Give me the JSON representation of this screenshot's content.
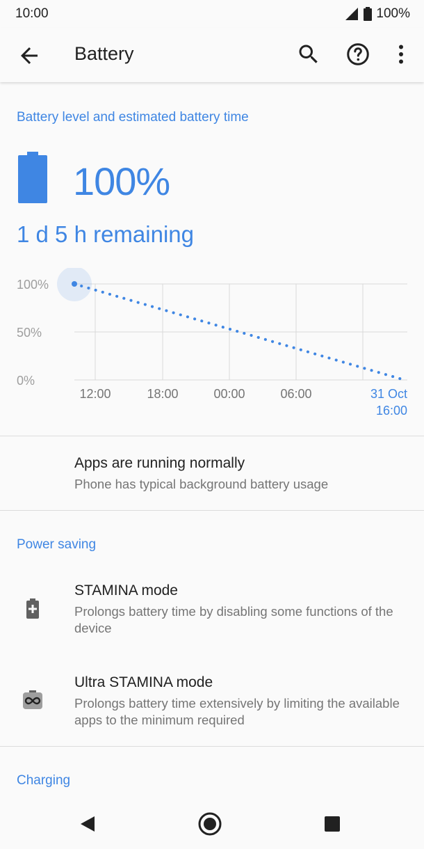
{
  "status_bar": {
    "time": "10:00",
    "battery_text": "100%"
  },
  "app_bar": {
    "title": "Battery",
    "back_icon": "arrow-back-icon",
    "search_icon": "search-icon",
    "help_icon": "help-icon",
    "more_icon": "more-vert-icon"
  },
  "battery_section": {
    "heading": "Battery level and estimated battery time",
    "percent": "100%",
    "remaining": "1 d 5 h remaining"
  },
  "chart_data": {
    "type": "line",
    "y_tick_labels": [
      "100%",
      "50%",
      "0%"
    ],
    "x_tick_labels": [
      "12:00",
      "18:00",
      "00:00",
      "06:00"
    ],
    "end_label": [
      "31 Oct",
      "16:00"
    ],
    "ylim": [
      0,
      100
    ],
    "series": [
      {
        "style": "dotted",
        "x": [
          "10:00",
          "31 Oct 16:00"
        ],
        "values": [
          100,
          0
        ]
      }
    ],
    "accent_color": "#3f86e3"
  },
  "apps_status": {
    "title": "Apps are running normally",
    "subtitle": "Phone has typical background battery usage"
  },
  "power_saving": {
    "heading": "Power saving",
    "items": [
      {
        "title": "STAMINA mode",
        "subtitle": "Prolongs battery time by disabling some functions of the device",
        "icon": "battery-plus-icon"
      },
      {
        "title": "Ultra STAMINA mode",
        "subtitle": "Prolongs battery time extensively by limiting the available apps to the minimum required",
        "icon": "infinity-battery-icon"
      }
    ]
  },
  "charging": {
    "heading": "Charging"
  },
  "nav_bar": {
    "back_icon": "nav-back-icon",
    "home_icon": "nav-home-icon",
    "recents_icon": "nav-recents-icon"
  }
}
